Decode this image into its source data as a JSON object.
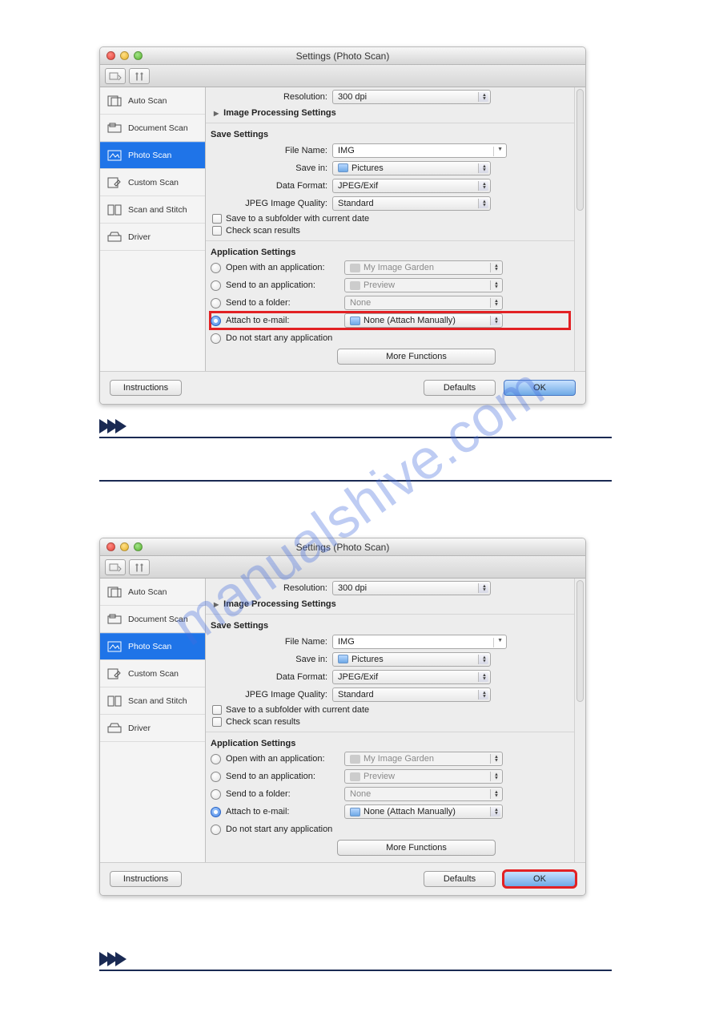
{
  "watermark": "manualshive.com",
  "window": {
    "title": "Settings (Photo Scan)",
    "sidebar": [
      {
        "label": "Auto Scan"
      },
      {
        "label": "Document Scan"
      },
      {
        "label": "Photo Scan"
      },
      {
        "label": "Custom Scan"
      },
      {
        "label": "Scan and Stitch"
      },
      {
        "label": "Driver"
      }
    ],
    "resolution": {
      "label": "Resolution:",
      "value": "300 dpi"
    },
    "image_processing": "Image Processing Settings",
    "save_settings": {
      "heading": "Save Settings",
      "file_name": {
        "label": "File Name:",
        "value": "IMG"
      },
      "save_in": {
        "label": "Save in:",
        "value": "Pictures"
      },
      "data_format": {
        "label": "Data Format:",
        "value": "JPEG/Exif"
      },
      "jpeg_quality": {
        "label": "JPEG Image Quality:",
        "value": "Standard"
      },
      "save_subfolder": "Save to a subfolder with current date",
      "check_results": "Check scan results"
    },
    "app_settings": {
      "heading": "Application Settings",
      "open_with": {
        "label": "Open with an application:",
        "value": "My Image Garden"
      },
      "send_app": {
        "label": "Send to an application:",
        "value": "Preview"
      },
      "send_folder": {
        "label": "Send to a folder:",
        "value": "None"
      },
      "attach_email": {
        "label": "Attach to e-mail:",
        "value": "None (Attach Manually)"
      },
      "no_start": "Do not start any application",
      "more_functions": "More Functions"
    },
    "footer": {
      "instructions": "Instructions",
      "defaults": "Defaults",
      "ok": "OK"
    }
  }
}
